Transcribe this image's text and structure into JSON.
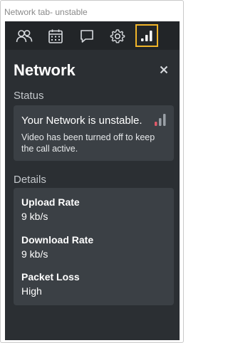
{
  "caption": "Network tab- unstable",
  "toolbar": {
    "icons": [
      {
        "name": "participants-icon"
      },
      {
        "name": "calendar-icon"
      },
      {
        "name": "chat-icon"
      },
      {
        "name": "settings-icon"
      },
      {
        "name": "network-signal-icon",
        "active": true
      }
    ],
    "accent_color": "#f0b429"
  },
  "panel": {
    "title": "Network",
    "close_icon": "close-icon",
    "status_section_label": "Status",
    "status": {
      "message": "Your Network is unstable.",
      "detail": "Video has been turned off to keep the call active.",
      "signal_bars_active": 1,
      "signal_bars_total": 3,
      "signal_active_color": "#e05a6a",
      "signal_inactive_color": "#9aa0a6"
    },
    "details_section_label": "Details",
    "details": [
      {
        "label": "Upload Rate",
        "value": "9 kb/s"
      },
      {
        "label": "Download Rate",
        "value": "9 kb/s"
      },
      {
        "label": "Packet Loss",
        "value": "High"
      }
    ]
  }
}
